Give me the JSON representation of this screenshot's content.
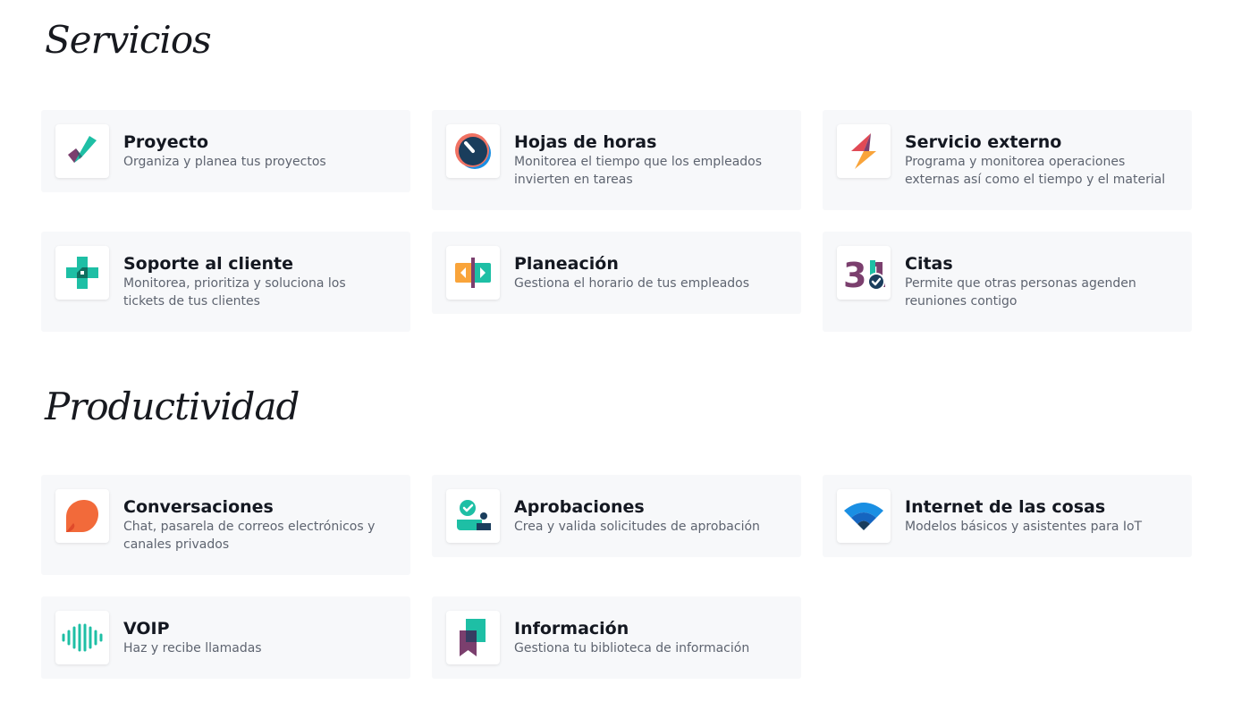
{
  "sections": [
    {
      "title": "Servicios",
      "cards": [
        {
          "title": "Proyecto",
          "description": "Organiza y planea tus proyectos",
          "icon": "project-check-icon"
        },
        {
          "title": "Hojas de horas",
          "description": "Monitorea el tiempo que los empleados invierten en tareas",
          "icon": "timer-icon"
        },
        {
          "title": "Servicio externo",
          "description": "Programa y monitorea operaciones externas así como el tiempo y el material",
          "icon": "lightning-icon"
        },
        {
          "title": "Soporte al cliente",
          "description": "Monitorea, prioritiza y soluciona los tickets de tus clientes",
          "icon": "support-cross-icon"
        },
        {
          "title": "Planeación",
          "description": "Gestiona el horario de tus empleados",
          "icon": "planning-icon"
        },
        {
          "title": "Citas",
          "description": "Permite que otras personas agenden reuniones contigo",
          "icon": "calendar-31-icon",
          "icon_text": "31"
        }
      ]
    },
    {
      "title": "Productividad",
      "cards": [
        {
          "title": "Conversaciones",
          "description": "Chat, pasarela de correos electrónicos y canales privados",
          "icon": "chat-bubble-icon"
        },
        {
          "title": "Aprobaciones",
          "description": "Crea y valida solicitudes de aprobación",
          "icon": "approval-icon"
        },
        {
          "title": "Internet de las cosas",
          "description": "Modelos básicos y asistentes para IoT",
          "icon": "wifi-icon"
        },
        {
          "title": "VOIP",
          "description": "Haz y recibe llamadas",
          "icon": "soundwave-icon"
        },
        {
          "title": "Información",
          "description": "Gestiona tu biblioteca de información",
          "icon": "bookmark-icon"
        }
      ]
    }
  ],
  "colors": {
    "card_bg": "#f7f8fa",
    "teal": "#1ebfa5",
    "purple": "#7b3f6e",
    "orange": "#f26a3a",
    "blue": "#1a8fe3",
    "navy": "#1a3d5c"
  }
}
